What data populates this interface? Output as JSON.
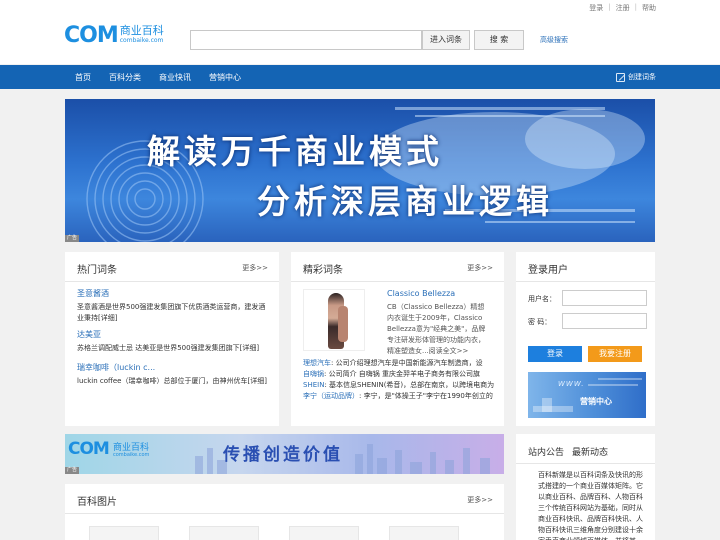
{
  "toplinks": {
    "login": "登录",
    "register": "注册",
    "help": "帮助",
    "separator": "|"
  },
  "logo": {
    "com": "COM",
    "cn": "商业百科",
    "en": "combaike.com"
  },
  "search": {
    "value": "",
    "placeholder": "",
    "entry_label": "进入词条",
    "search_label": "搜 索",
    "advanced_label": "高级搜索"
  },
  "nav": {
    "items": [
      "首页",
      "百科分类",
      "商业快讯",
      "营销中心"
    ],
    "create_label": "创建词条"
  },
  "banner": {
    "line1": "解读万千商业模式",
    "line2": "分析深层商业逻辑",
    "ad_tag": "广告"
  },
  "hot": {
    "title": "热门词条",
    "more": "更多>>",
    "items": [
      {
        "name": "圣意酱酒",
        "desc": "圣意酱酒是世界500强建发集团旗下优质酒类运营商，建发酒业秉持[详细]"
      },
      {
        "name": "达美亚",
        "desc": "苏格兰调配威士忌 达美亚是世界500强建发集团旗下[详细]"
      },
      {
        "name": "瑞幸咖啡（luckin c...",
        "desc": "luckin coffee（瑞幸咖啡）总部位于厦门，由神州优车[详细]"
      }
    ]
  },
  "fine": {
    "title": "精彩词条",
    "more": "更多>>",
    "feature_name": "Classico Bellezza",
    "feature_desc": "CB（Classico Bellezza）精想内衣诞生于2009年，Classico Bellezza意为\"经典之美\"，品牌专注研发形体管理的功能内衣，精准塑造女...阅读全文>>",
    "rows": [
      {
        "k": "理想汽车",
        "v": ": 公司介绍理想汽车是中国新能源汽车制造商，设"
      },
      {
        "k": "自嗨锅",
        "v": ": 公司简介     自嗨锅 重庆金羿羊电子商务有限公司旗"
      },
      {
        "k": "SHEIN",
        "v": ": 基本信息SHENIN(希音)，总部在南京，以跨境电商为"
      },
      {
        "k": "李宁（运动品牌）",
        "v": ": 李宁，是\"体操王子\"李宁在1990年创立的"
      }
    ]
  },
  "login": {
    "title": "登录用户",
    "username_label": "用户名：",
    "password_label": "密  码：",
    "login_label": "登录",
    "register_label": "我要注册",
    "promo_label": "营销中心",
    "promo_www": "WWW."
  },
  "banner2": {
    "com": "COM",
    "cn": "商业百科",
    "en": "combaike.com",
    "slogan": "传播创造价值",
    "ad_tag": "广告"
  },
  "pics": {
    "title": "百科图片",
    "more": "更多>>"
  },
  "notice": {
    "tab1": "站内公告",
    "tab2": "最新动态",
    "body": "百科新媒是以百科词条及快讯的形式搭建的一个商业百媒体矩阵。它以商业百科、品牌百科、人物百科三个传统百科网站为基础，同时从商业百科快讯、品牌百科快讯、人物百科快讯三维角度分别建设十余家垂直商业领域百媒体，并将其"
  },
  "colors": {
    "brand": "#1d8fe0",
    "nav": "#1464b4",
    "link": "#2a6fb8",
    "login_btn": "#1d7fde",
    "register_btn": "#f39a1a"
  }
}
